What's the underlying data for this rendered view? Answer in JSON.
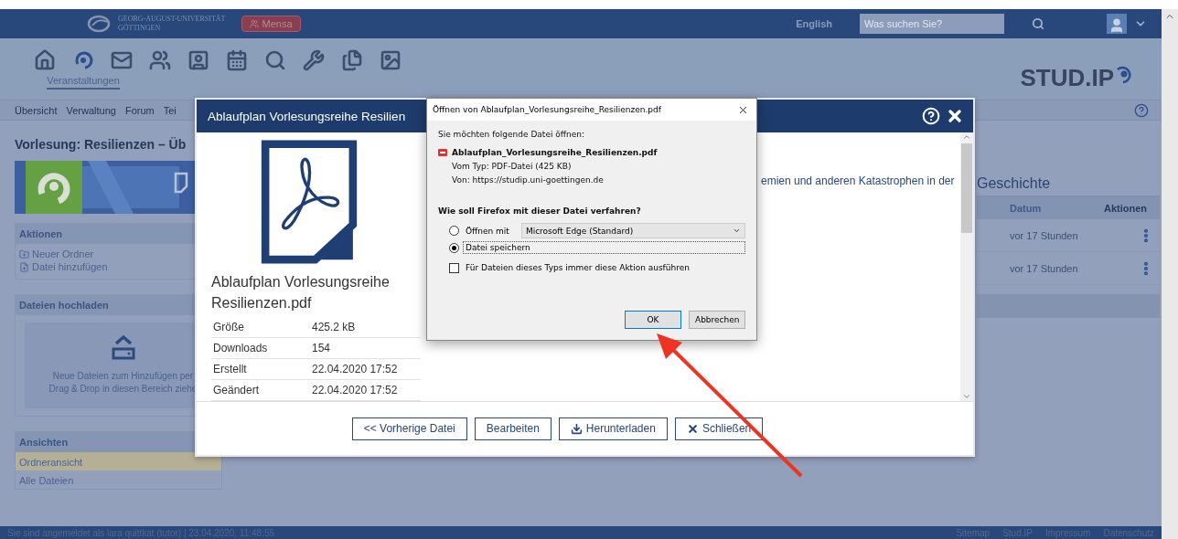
{
  "top_bar": {
    "logo_lines": [
      "GEORG-AUGUST-UNIVERSITÄT",
      "GÖTTINGEN"
    ],
    "mensa_button": "Mensa",
    "language": "English",
    "search": {
      "placeholder": "Was suchen Sie?"
    }
  },
  "nav": {
    "items": [
      {
        "kind": "home",
        "selected": false
      },
      {
        "kind": "courses",
        "label": "Veranstaltungen",
        "selected": true
      },
      {
        "kind": "messages",
        "selected": false
      },
      {
        "kind": "community",
        "selected": false
      },
      {
        "kind": "profile",
        "selected": false
      },
      {
        "kind": "schedule",
        "selected": false
      },
      {
        "kind": "search",
        "selected": false
      },
      {
        "kind": "tools",
        "selected": false
      },
      {
        "kind": "files",
        "selected": false
      },
      {
        "kind": "gallery",
        "selected": false
      }
    ],
    "brand": "STUD.IP"
  },
  "tabs": [
    "Übersicht",
    "Verwaltung",
    "Forum",
    "Tei"
  ],
  "page_title": "Vorlesung: Resilienzen – Üb",
  "sidebar": {
    "sections": [
      {
        "kind": "actions",
        "title": "Aktionen",
        "items": [
          {
            "kind": "folder",
            "label": "Neuer Ordner"
          },
          {
            "kind": "file",
            "label": "Datei hinzufügen"
          }
        ]
      },
      {
        "kind": "upload",
        "title": "Dateien hochladen",
        "lines": [
          "Neue Dateien zum Hinzufügen per",
          "Drag & Drop in diesen Bereich ziehe"
        ]
      },
      {
        "kind": "views",
        "title": "Ansichten",
        "items": [
          {
            "label": "Ordneransicht",
            "selected": true
          },
          {
            "label": "Alle Dateien",
            "selected": false
          }
        ]
      }
    ]
  },
  "history": {
    "title": "Geschichte",
    "columns": [
      "Datum",
      "Aktionen"
    ],
    "rows": [
      {
        "date": "vor 17 Stunden"
      },
      {
        "date": "vor 17 Stunden"
      }
    ]
  },
  "footer": {
    "text": "Sie sind angemeldet als lara quittkat (tutor) | 23.04.2020, 11:48:55",
    "links": [
      "Sitemap",
      "Stud.IP",
      "Impressum",
      "Datenschutz"
    ]
  },
  "file_dialog": {
    "title": "Ablaufplan Vorlesungsreihe Resilien",
    "file_name": "Ablaufplan Vorlesungsreihe Resilienzen.pdf",
    "details": [
      {
        "label": "Größe",
        "value": "425.2 kB"
      },
      {
        "label": "Downloads",
        "value": "154"
      },
      {
        "label": "Erstellt",
        "value": "22.04.2020 17:52"
      },
      {
        "label": "Geändert",
        "value": "22.04.2020 17:52"
      }
    ],
    "description": "emien und anderen Katastrophen in der",
    "buttons": [
      "<< Vorherige Datei",
      "Bearbeiten",
      "Herunterladen",
      "Schließen"
    ]
  },
  "download_dialog": {
    "title": "Öffnen von Ablaufplan_Vorlesungsreihe_Resilienzen.pdf",
    "prompt": "Sie möchten folgende Datei öffnen:",
    "file_name": "Ablaufplan_Vorlesungsreihe_Resilienzen.pdf",
    "type": "Vom Typ: PDF-Datei (425 KB)",
    "source": "Von: https://studip.uni-goettingen.de",
    "question": "Wie soll Firefox mit dieser Datei verfahren?",
    "options": [
      {
        "label": "Öffnen mit",
        "selected": false
      },
      {
        "label": "Datei speichern",
        "selected": true
      }
    ],
    "app_select": "Microsoft Edge (Standard)",
    "always": {
      "label": "Für Dateien dieses Typs immer diese Aktion ausführen",
      "checked": false
    },
    "buttons": [
      "OK",
      "Abbrechen"
    ]
  }
}
